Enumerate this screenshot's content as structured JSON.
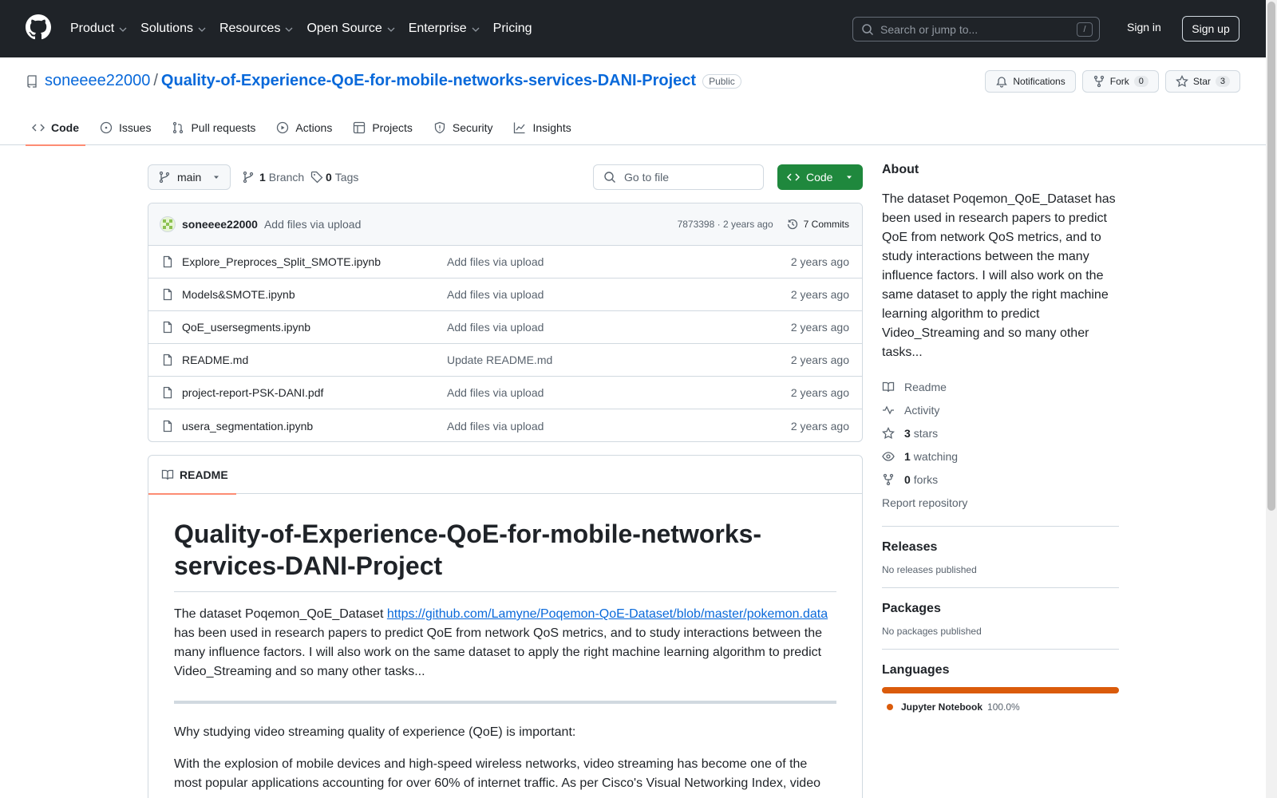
{
  "header": {
    "nav": [
      "Product",
      "Solutions",
      "Resources",
      "Open Source",
      "Enterprise",
      "Pricing"
    ],
    "search_placeholder": "Search or jump to...",
    "search_shortcut": "/",
    "signin_label": "Sign in",
    "signup_label": "Sign up"
  },
  "repo": {
    "owner": "soneeee22000",
    "separator": "/",
    "name": "Quality-of-Experience-QoE-for-mobile-networks-services-DANI-Project",
    "visibility": "Public",
    "notifications_label": "Notifications",
    "fork_label": "Fork",
    "fork_count": "0",
    "star_label": "Star",
    "star_count": "3"
  },
  "tabs": [
    "Code",
    "Issues",
    "Pull requests",
    "Actions",
    "Projects",
    "Security",
    "Insights"
  ],
  "toolbar": {
    "branch": "main",
    "branch_count": "1",
    "branch_label": "Branch",
    "tag_count": "0",
    "tag_label": "Tags",
    "goto_placeholder": "Go to file",
    "code_label": "Code"
  },
  "latest_commit": {
    "author": "soneeee22000",
    "message": "Add files via upload",
    "meta": "7873398 · 2 years ago",
    "commits_label": "7 Commits"
  },
  "files": [
    {
      "name": "Explore_Preproces_Split_SMOTE.ipynb",
      "message": "Add files via upload",
      "time": "2 years ago"
    },
    {
      "name": "Models&SMOTE.ipynb",
      "message": "Add files via upload",
      "time": "2 years ago"
    },
    {
      "name": "QoE_usersegments.ipynb",
      "message": "Add files via upload",
      "time": "2 years ago"
    },
    {
      "name": "README.md",
      "message": "Update README.md",
      "time": "2 years ago"
    },
    {
      "name": "project-report-PSK-DANI.pdf",
      "message": "Add files via upload",
      "time": "2 years ago"
    },
    {
      "name": "usera_segmentation.ipynb",
      "message": "Add files via upload",
      "time": "2 years ago"
    }
  ],
  "readme": {
    "tab_label": "README",
    "title": "Quality-of-Experience-QoE-for-mobile-networks-services-DANI-Project",
    "p1_prefix": "The dataset Poqemon_QoE_Dataset ",
    "p1_link": "https://github.com/Lamyne/Poqemon-QoE-Dataset/blob/master/pokemon.data",
    "p1_suffix": " has been used in research papers to predict QoE from network QoS metrics, and to study interactions between the many influence factors. I will also work on the same dataset to apply the right machine learning algorithm to predict Video_Streaming and so many other tasks...",
    "p2": "Why studying video streaming quality of experience (QoE) is important:",
    "p3": "With the explosion of mobile devices and high-speed wireless networks, video streaming has become one of the most popular applications accounting for over 60% of internet traffic. As per Cisco's Visual Networking Index, video"
  },
  "about": {
    "heading": "About",
    "description": "The dataset Poqemon_QoE_Dataset has been used in research papers to predict QoE from network QoS metrics, and to study interactions between the many influence factors. I will also work on the same dataset to apply the right machine learning algorithm to predict Video_Streaming and so many other tasks...",
    "readme_label": "Readme",
    "activity_label": "Activity",
    "stars_count": "3",
    "stars_label": "stars",
    "watching_count": "1",
    "watching_label": "watching",
    "forks_count": "0",
    "forks_label": "forks",
    "report_label": "Report repository"
  },
  "releases": {
    "heading": "Releases",
    "empty": "No releases published"
  },
  "packages": {
    "heading": "Packages",
    "empty": "No packages published"
  },
  "languages": {
    "heading": "Languages",
    "items": [
      {
        "name": "Jupyter Notebook",
        "percent": "100.0%",
        "color": "#da5b0b"
      }
    ]
  },
  "colors": {
    "header_bg": "#1f2328",
    "link": "#0969da",
    "primary_button": "#1f883d",
    "active_tab": "#fd8c73"
  }
}
